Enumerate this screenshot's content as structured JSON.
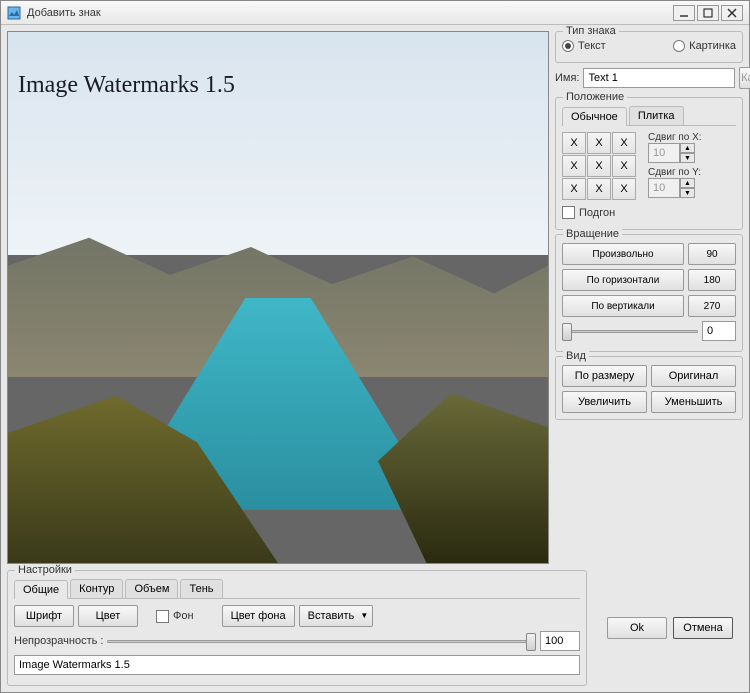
{
  "window": {
    "title": "Добавить знак"
  },
  "preview": {
    "watermark": "Image Watermarks 1.5"
  },
  "type_group": {
    "label": "Тип знака",
    "opt_text": "Текст",
    "opt_image": "Картинка"
  },
  "name": {
    "label": "Имя:",
    "value": "Text 1",
    "image_btn": "Картинка"
  },
  "position": {
    "label": "Положение",
    "tab_normal": "Обычное",
    "tab_tile": "Плитка",
    "shift_x": "Сдвиг по X:",
    "shift_y": "Сдвиг по Y:",
    "shift_x_val": "10",
    "shift_y_val": "10",
    "fit": "Подгон",
    "x": "X"
  },
  "rotation": {
    "label": "Вращение",
    "free": "Произвольно",
    "horiz": "По горизонтали",
    "vert": "По вертикали",
    "v90": "90",
    "v180": "180",
    "v270": "270",
    "slider_val": "0"
  },
  "view": {
    "label": "Вид",
    "fit": "По размеру",
    "original": "Оригинал",
    "zoom_in": "Увеличить",
    "zoom_out": "Уменьшить"
  },
  "settings": {
    "label": "Настройки",
    "tab_general": "Общие",
    "tab_outline": "Контур",
    "tab_volume": "Объем",
    "tab_shadow": "Тень",
    "font": "Шрифт",
    "color": "Цвет",
    "bg": "Фон",
    "bg_color": "Цвет фона",
    "insert": "Вставить",
    "opacity": "Непрозрачность :",
    "opacity_val": "100",
    "text_value": "Image Watermarks 1.5"
  },
  "actions": {
    "ok": "Ok",
    "cancel": "Отмена"
  }
}
